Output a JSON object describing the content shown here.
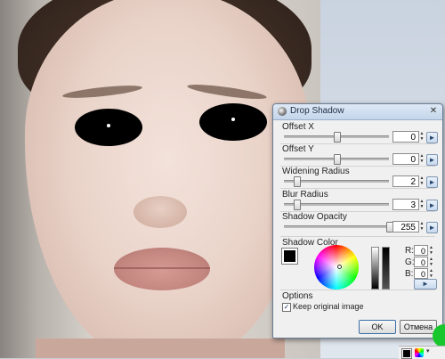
{
  "dialog": {
    "title": "Drop Shadow",
    "close_glyph": "✕",
    "rows": [
      {
        "label": "Offset X",
        "value": "0",
        "fraction": 0.5
      },
      {
        "label": "Offset Y",
        "value": "0",
        "fraction": 0.5
      },
      {
        "label": "Widening Radius",
        "value": "2",
        "fraction": 0.12
      },
      {
        "label": "Blur Radius",
        "value": "3",
        "fraction": 0.12
      },
      {
        "label": "Shadow Opacity",
        "value": "255",
        "fraction": 1.0
      }
    ],
    "shadow_color_label": "Shadow Color",
    "rgb": [
      {
        "label": "R:",
        "value": "0"
      },
      {
        "label": "G:",
        "value": "0"
      },
      {
        "label": "B:",
        "value": "0"
      }
    ],
    "more_button": "►",
    "reset_glyph": "◄",
    "options_label": "Options",
    "keep_original_label": "Keep original image",
    "keep_original_checked": true,
    "checkmark": "✓",
    "ok_label": "OK",
    "cancel_label": "Отмена"
  },
  "colors": {
    "shadow": "#000000",
    "titlebar": "#c4d5ea"
  },
  "icons": {
    "title": "drop-shadow-icon",
    "close": "close-icon",
    "reset": "reset-arrow-icon",
    "more": "more-arrow-icon"
  },
  "mini_toolbar": {
    "arrow": "▾"
  }
}
